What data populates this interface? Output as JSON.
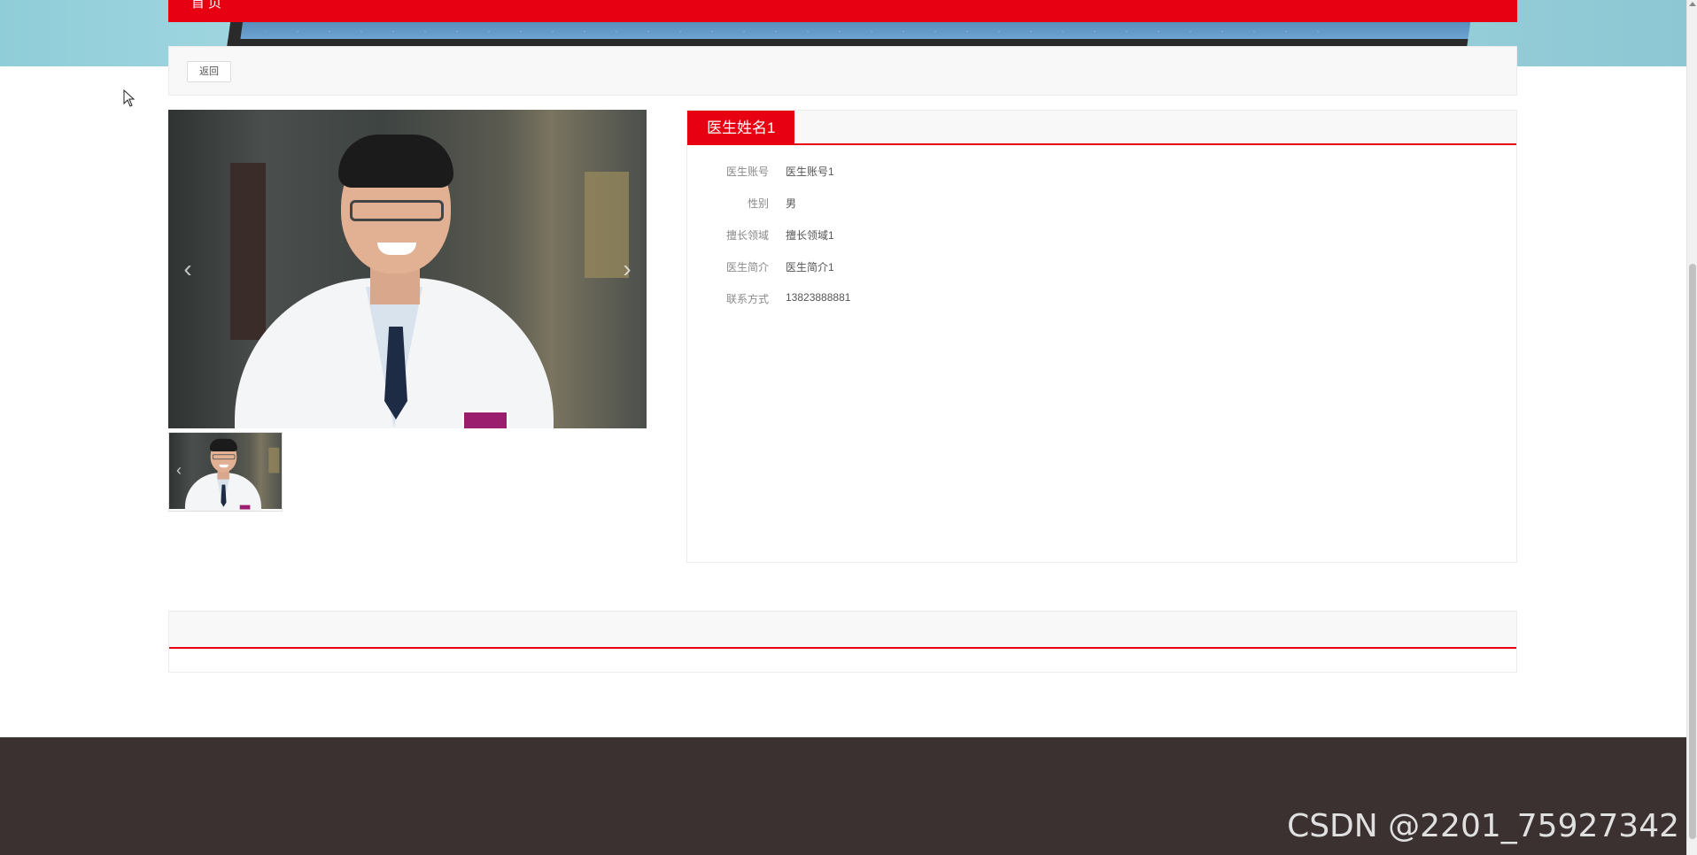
{
  "nav": {
    "home_label": "首页"
  },
  "backbar": {
    "back_label": "返回"
  },
  "gallery": {
    "prev_arrow": "‹",
    "next_arrow": "›"
  },
  "doctor": {
    "name": "医生姓名1",
    "fields": [
      {
        "label": "医生账号",
        "value": "医生账号1"
      },
      {
        "label": "性别",
        "value": "男"
      },
      {
        "label": "擅长领域",
        "value": "擅长领域1"
      },
      {
        "label": "医生简介",
        "value": "医生简介1"
      },
      {
        "label": "联系方式",
        "value": "13823888881"
      }
    ]
  },
  "footer": {
    "watermark": "CSDN @2201_75927342"
  },
  "colors": {
    "accent": "#e60012",
    "footer_bg": "#3b3131"
  },
  "icons": {
    "cursor": "mouse-pointer-icon",
    "prev": "chevron-left-icon",
    "next": "chevron-right-icon"
  }
}
